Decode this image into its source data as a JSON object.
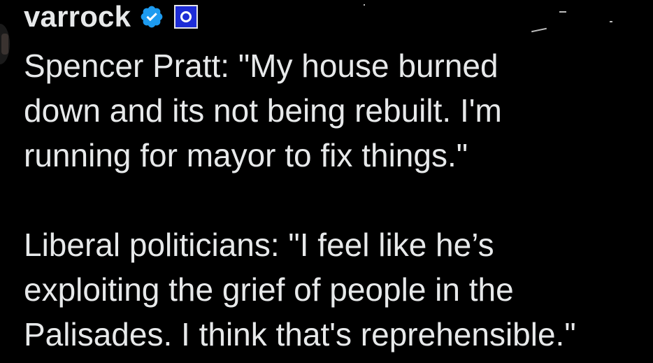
{
  "author": {
    "display_name": "varrock",
    "verified_icon": "verified-badge-icon",
    "affiliate_icon": "affiliate-badge-icon",
    "verified_color": "#1d9bf0",
    "affiliate_color": "#1d2cd6"
  },
  "tweet": {
    "paragraph_1": "Spencer Pratt: \"My house burned\ndown and its not being rebuilt. I'm\nrunning for mayor to fix things.\"",
    "paragraph_2": "Liberal politicians: \"I feel like he’s\nexploiting the grief of people in the\nPalisades. I think that's reprehensible.\""
  },
  "theme": {
    "background": "#000000",
    "text": "#e7e9ea"
  }
}
